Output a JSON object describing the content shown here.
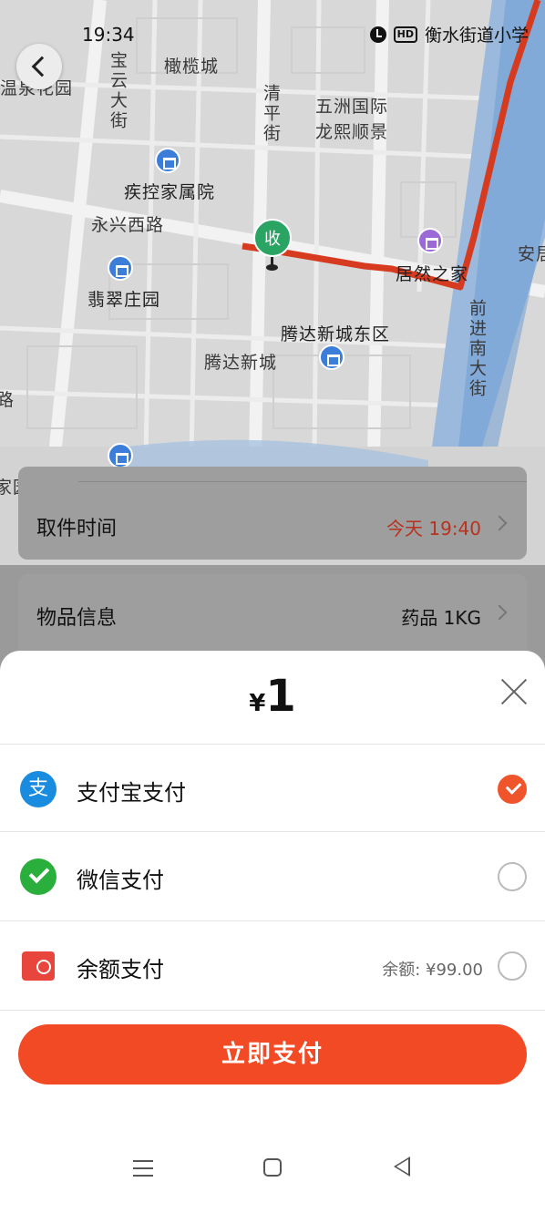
{
  "status_bar": {
    "time": "19:34",
    "right_text": "衡水街道小学"
  },
  "map": {
    "labels": {
      "baoyun_street": "宝云大街",
      "ganlan_city": "橄榄城",
      "wenquan_garden": "温泉花园",
      "qingping_street": "清平街",
      "wuzhou": "五洲国际",
      "longxi": "龙熙顺景",
      "cdc_housing": "疾控家属院",
      "yongxing_road": "永兴西路",
      "jucui_garden": "翡翠庄园",
      "juran_home": "居然之家",
      "tengda_east": "腾达新城东区",
      "tengda_city": "腾达新城",
      "qianjin_south": "前进南大街",
      "an_edge": "安居",
      "lu_edge": "路",
      "jia_edge": "家园"
    },
    "pin_label": "收"
  },
  "order": {
    "pickup_time_label": "取件时间",
    "pickup_time_value": "今天 19:40",
    "item_info_label": "物品信息",
    "item_info_value": "药品 1KG"
  },
  "payment_sheet": {
    "currency_symbol": "¥",
    "amount": "1",
    "methods": [
      {
        "label": "支付宝支付",
        "icon": "alipay-icon",
        "icon_char": "支",
        "selected": true,
        "extra": ""
      },
      {
        "label": "微信支付",
        "icon": "wechat-icon",
        "icon_char": "",
        "selected": false,
        "extra": ""
      },
      {
        "label": "余额支付",
        "icon": "wallet-icon",
        "icon_char": "",
        "selected": false,
        "extra": "余额: ¥99.00"
      }
    ],
    "pay_button_label": "立即支付"
  },
  "colors": {
    "accent": "#f24a25",
    "alipay": "#1a8ce0",
    "wechat": "#2aae3c",
    "route": "#d63a1f",
    "pin": "#2aa463"
  }
}
